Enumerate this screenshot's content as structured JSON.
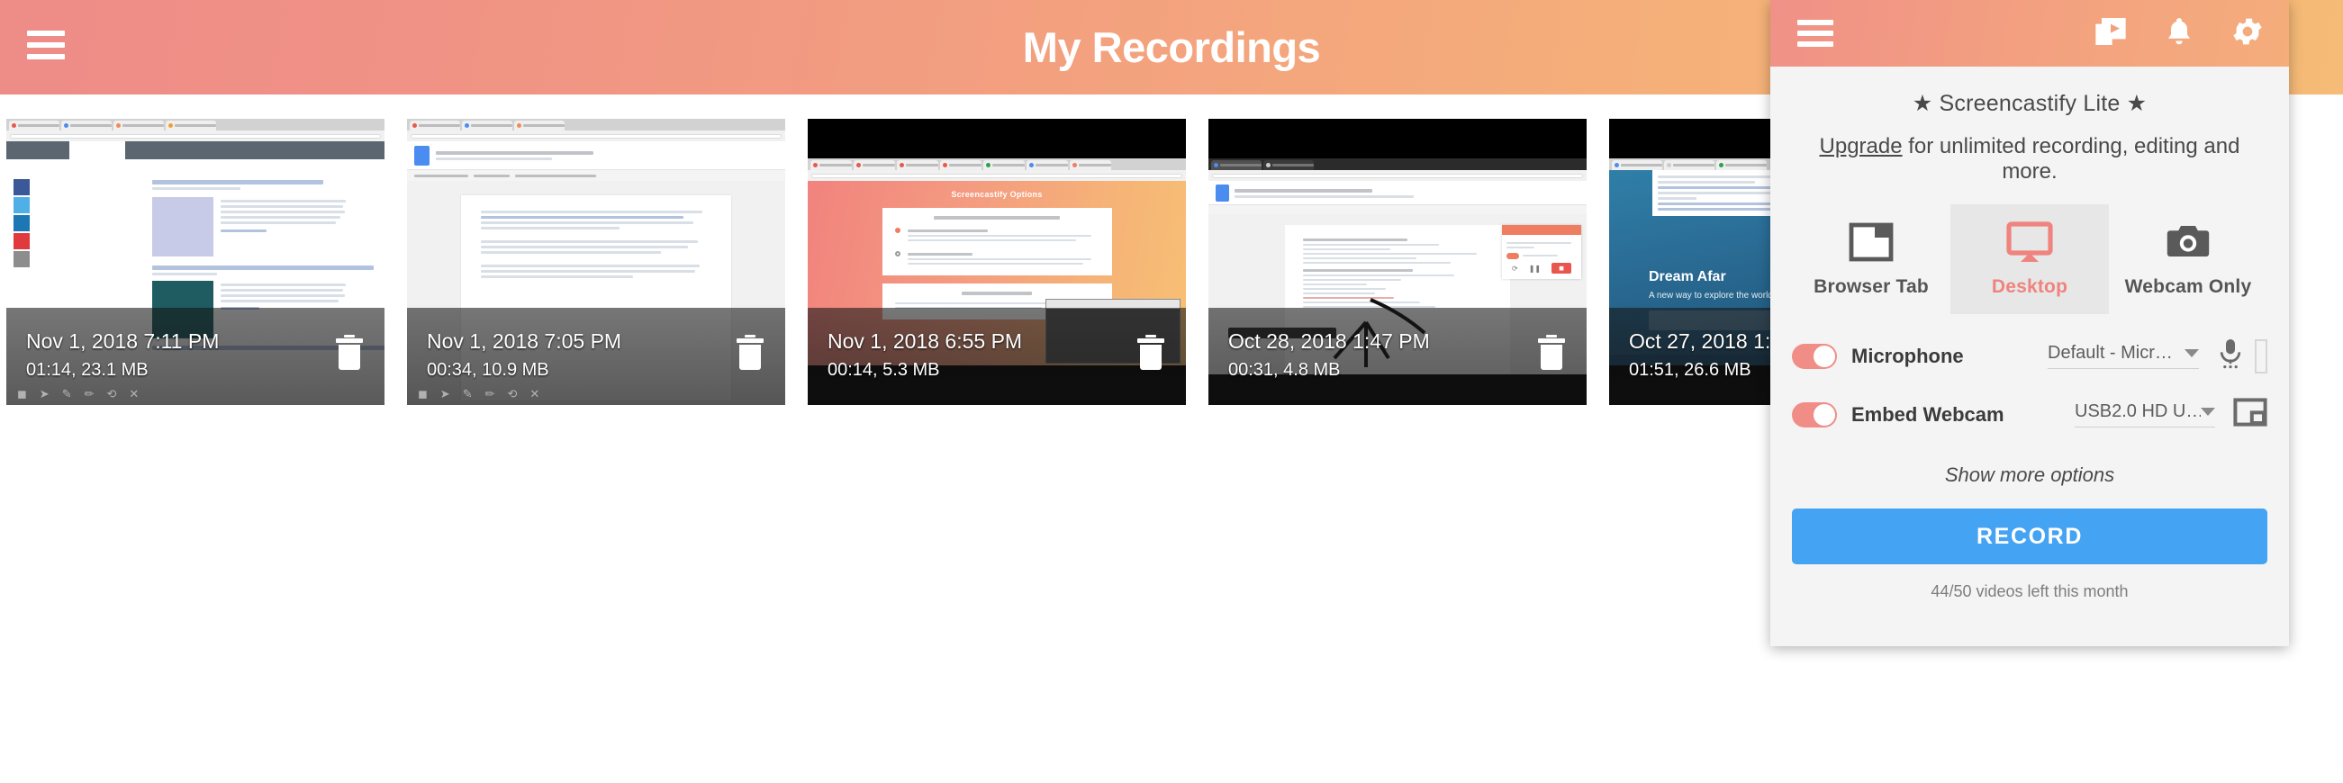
{
  "appbar": {
    "title": "My Recordings",
    "menu_icon": "hamburger-menu-icon"
  },
  "recordings": [
    {
      "date": "Nov 1, 2018 7:11 PM",
      "duration_size": "01:14, 23.1 MB",
      "duration": "01:14",
      "size": "23.1 MB",
      "thumbnail_description": "Zapier blog page with article list",
      "delete_icon": "trash-icon"
    },
    {
      "date": "Nov 1, 2018 7:05 PM",
      "duration_size": "00:34, 10.9 MB",
      "duration": "00:34",
      "size": "10.9 MB",
      "thumbnail_description": "Google Doc - Zapier App Roundup - Best Screen Recorders - Ryan Farley",
      "delete_icon": "trash-icon"
    },
    {
      "date": "Nov 1, 2018 6:55 PM",
      "duration_size": "00:14, 5.3 MB",
      "duration": "00:14",
      "size": "5.3 MB",
      "thumbnail_description": "Screencastify Options page",
      "delete_icon": "trash-icon"
    },
    {
      "date": "Oct 28, 2018 1:47 PM",
      "duration_size": "00:31, 4.8 MB",
      "duration": "00:31",
      "size": "4.8 MB",
      "thumbnail_description": "Google Doc with annotation arrow and Screencastify recording panel",
      "delete_icon": "trash-icon"
    },
    {
      "date": "Oct 27, 2018 1:",
      "duration_size": "01:51, 26.6 MB",
      "duration": "01:51",
      "size": "26.6 MB",
      "thumbnail_description": "Dream Afar new tab page - A new way to explore the world",
      "delete_icon": "trash-icon"
    }
  ],
  "panel": {
    "header": {
      "menu_icon": "hamburger-menu-icon",
      "icons": [
        {
          "name": "my-recordings-icon"
        },
        {
          "name": "notifications-bell-icon"
        },
        {
          "name": "settings-gear-icon"
        }
      ]
    },
    "lite_title": "★ Screencastify Lite ★",
    "upgrade_link": "Upgrade",
    "upgrade_rest": " for unlimited recording, editing and more.",
    "modes": [
      {
        "label": "Browser Tab",
        "icon": "browser-tab-icon",
        "selected": false
      },
      {
        "label": "Desktop",
        "icon": "desktop-monitor-icon",
        "selected": true
      },
      {
        "label": "Webcam Only",
        "icon": "camera-icon",
        "selected": false
      }
    ],
    "microphone": {
      "label": "Microphone",
      "enabled": true,
      "device": "Default - Micr…",
      "trail_icon": "microphone-icon",
      "level_meter": "mic-level-meter"
    },
    "webcam": {
      "label": "Embed Webcam",
      "enabled": true,
      "device": "USB2.0 HD U…",
      "trail_icon": "webcam-position-icon"
    },
    "show_more": "Show more options",
    "record_button": "RECORD",
    "quota": "44/50 videos left this month"
  },
  "colors": {
    "accent_coral": "#f08d86",
    "accent_orange": "#f5b079",
    "record_blue": "#45a3f4",
    "panel_bg": "#f4f4f4",
    "selected_mode_bg": "#e7e7e7"
  }
}
